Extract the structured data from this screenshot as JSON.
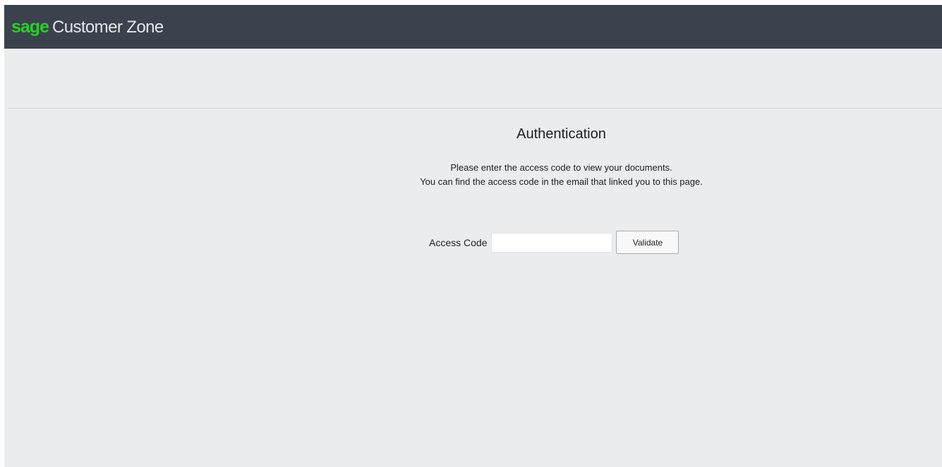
{
  "header": {
    "logo_text": "sage",
    "app_title": "Customer Zone",
    "brand_color": "#24d323",
    "bar_color": "#3c414e"
  },
  "main": {
    "title": "Authentication",
    "intro_line1": "Please enter the access code to view your documents.",
    "intro_line2": "You can find the access code in the email that linked you to this page.",
    "access_code_label": "Access Code",
    "access_code_value": "",
    "validate_label": "Validate"
  }
}
